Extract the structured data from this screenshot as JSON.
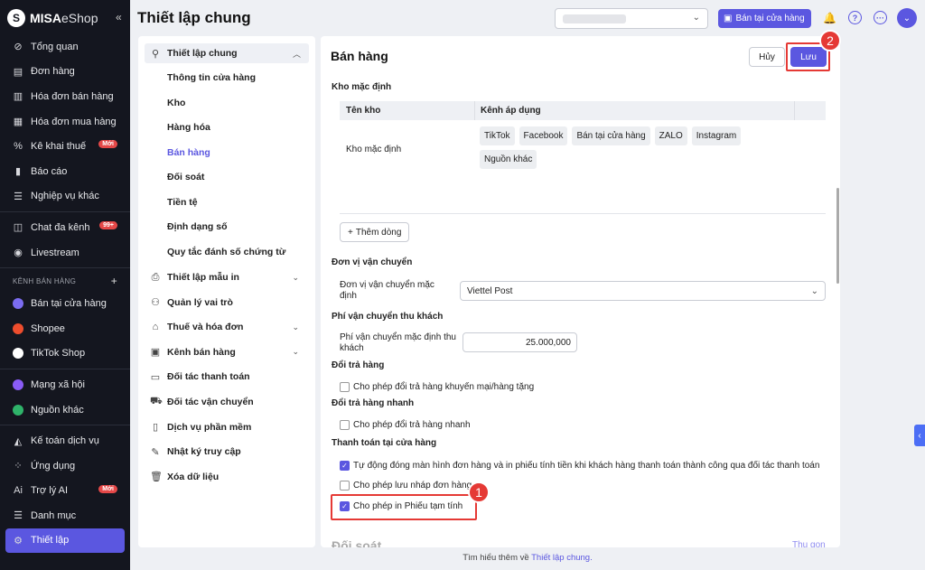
{
  "brand": {
    "logo_letter": "S",
    "name_bold": "MISA",
    "name_rest": "eShop",
    "collapse": "«"
  },
  "sidebar": {
    "items": [
      {
        "label": "Tổng quan",
        "icon": "⊘"
      },
      {
        "label": "Đơn hàng",
        "icon": "▤"
      },
      {
        "label": "Hóa đơn bán hàng",
        "icon": "▥"
      },
      {
        "label": "Hóa đơn mua hàng",
        "icon": "▦"
      },
      {
        "label": "Kê khai thuế",
        "icon": "%",
        "badge": "Mới"
      },
      {
        "label": "Báo cáo",
        "icon": "▮"
      },
      {
        "label": "Nghiệp vụ khác",
        "icon": "☰"
      }
    ],
    "items2": [
      {
        "label": "Chat đa kênh",
        "icon": "◫",
        "badge": "99+"
      },
      {
        "label": "Livestream",
        "icon": "◉"
      }
    ],
    "channel_header": "KÊNH BÁN HÀNG",
    "channel_plus": "+",
    "channels": [
      {
        "label": "Bán tại cửa hàng",
        "color": "#7b6cf0"
      },
      {
        "label": "Shopee",
        "color": "#ee4d2d"
      },
      {
        "label": "TikTok Shop",
        "color": "#ffffff"
      }
    ],
    "channels2": [
      {
        "label": "Mạng xã hội",
        "color": "#8a5cf6"
      },
      {
        "label": "Nguồn khác",
        "color": "#2fb36a"
      }
    ],
    "items3": [
      {
        "label": "Kế toán dịch vụ",
        "icon": "◭"
      },
      {
        "label": "Ứng dụng",
        "icon": "⁘"
      },
      {
        "label": "Trợ lý AI",
        "icon": "Ai",
        "badge": "Mới"
      },
      {
        "label": "Danh mục",
        "icon": "☰"
      },
      {
        "label": "Thiết lập",
        "icon": "⚙",
        "active": true
      }
    ]
  },
  "header": {
    "title": "Thiết lập chung",
    "pos_button": "Bán tại cửa hàng",
    "bell": "🔔",
    "help": "?",
    "more": "···",
    "avatar": "⌄",
    "chev": "⌄"
  },
  "menu": {
    "open_item": {
      "label": "Thiết lập chung",
      "icon": "⚲",
      "chev": "︿"
    },
    "subs": [
      "Thông tin cửa hàng",
      "Kho",
      "Hàng hóa",
      "Bán hàng",
      "Đối soát",
      "Tiền tệ",
      "Định dạng số",
      "Quy tắc đánh số chứng từ"
    ],
    "selected": "Bán hàng",
    "items": [
      {
        "label": "Thiết lập mẫu in",
        "icon": "⎙",
        "chev": "⌄"
      },
      {
        "label": "Quản lý vai trò",
        "icon": "⚇"
      },
      {
        "label": "Thuế và hóa đơn",
        "icon": "⌂",
        "chev": "⌄"
      },
      {
        "label": "Kênh bán hàng",
        "icon": "▣",
        "chev": "⌄"
      },
      {
        "label": "Đối tác thanh toán",
        "icon": "▭"
      },
      {
        "label": "Đối tác vận chuyển",
        "icon": "⛟"
      },
      {
        "label": "Dịch vụ phần mềm",
        "icon": "▯"
      },
      {
        "label": "Nhật ký truy cập",
        "icon": "✎"
      },
      {
        "label": "Xóa dữ liệu",
        "icon": "🗑"
      }
    ]
  },
  "content": {
    "title": "Bán hàng",
    "cancel": "Hủy",
    "save": "Lưu",
    "warehouse_section": "Kho mặc định",
    "table": {
      "col1": "Tên kho",
      "col2": "Kênh áp dụng",
      "row_name": "Kho mặc định",
      "tags": [
        "TikTok",
        "Facebook",
        "Bán tại cửa hàng",
        "ZALO",
        "Instagram",
        "Nguồn khác"
      ]
    },
    "add_row": "Thêm dòng",
    "add_plus": "+",
    "shipping_section": "Đơn vị vận chuyển",
    "shipping_label": "Đơn vị vận chuyển mặc định",
    "shipping_value": "Viettel Post",
    "fee_section": "Phí vận chuyển thu khách",
    "fee_label": "Phí vận chuyển mặc định thu khách",
    "fee_value": "25.000,000",
    "return_section": "Đổi trả hàng",
    "return_option": "Cho phép đổi trả hàng khuyến mại/hàng tặng",
    "quick_return_section": "Đổi trả hàng nhanh",
    "quick_return_option": "Cho phép đổi trả hàng nhanh",
    "pay_section": "Thanh toán tại cửa hàng",
    "pay_opt1": "Tự động đóng màn hình đơn hàng và in phiếu tính tiền khi khách hàng thanh toán thành công qua đối tác thanh toán",
    "pay_opt2": "Cho phép lưu nháp đơn hàng",
    "pay_opt3": "Cho phép in Phiếu tạm tính",
    "next_section": "Đối soát",
    "next_link": "Thu gọn"
  },
  "annotations": {
    "n1": "1",
    "n2": "2"
  },
  "footer": {
    "prefix": "Tìm hiểu thêm về ",
    "link": "Thiết lập chung."
  },
  "side_tab": "‹"
}
